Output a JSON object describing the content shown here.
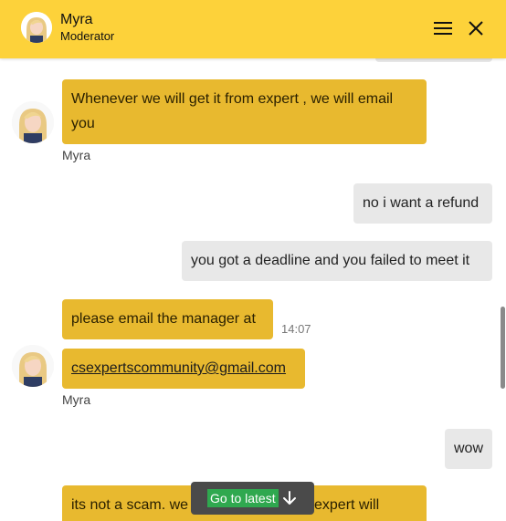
{
  "header": {
    "name": "Myra",
    "role": "Moderator",
    "menu_icon": "hamburger-menu-icon",
    "close_icon": "close-icon",
    "background_color": "#fdd23a"
  },
  "messages": [
    {
      "from": "agent",
      "text": "Whenever we will get it from expert , we will email you",
      "sender": "Myra"
    },
    {
      "from": "user",
      "text": "no i want a refund"
    },
    {
      "from": "user",
      "text": "you got a deadline and you failed to meet it"
    },
    {
      "from": "agent",
      "text": "please email the manager at",
      "time": "14:07"
    },
    {
      "from": "agent",
      "text": "csexpertscommunity@gmail.com",
      "is_link": true,
      "sender": "Myra"
    },
    {
      "from": "user",
      "text": "wow"
    },
    {
      "from": "agent",
      "text_left": "its not a scam. we",
      "text_right": "expert will"
    }
  ],
  "go_latest": {
    "label": "Go to latest",
    "icon": "arrow-down-icon"
  },
  "colors": {
    "agent_bubble": "#e8b92f",
    "user_bubble": "#e8e8e8",
    "go_latest_label_bg": "#2fa84f",
    "go_latest_bg": "#4a4a4a"
  }
}
